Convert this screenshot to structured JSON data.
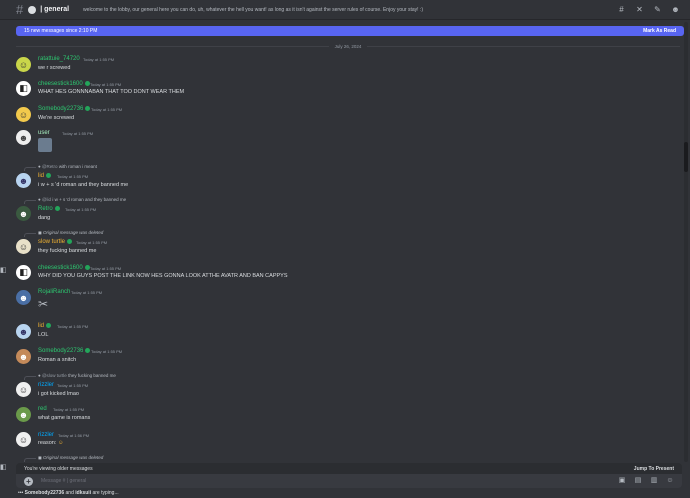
{
  "header": {
    "channel": "| general",
    "topic": "welcome to the lobby, our general here you can do, uh, whatever the hell you want! as long as it isn't against the server rules of course. Enjoy your stay! :)",
    "tools": [
      "threads-icon",
      "mute-bell-icon",
      "pin-icon",
      "members-icon"
    ]
  },
  "banner": {
    "text": "15 new messages since 2:10 PM",
    "action": "Mark As Read"
  },
  "date_divider": "July 26, 2024",
  "messages": [
    {
      "name": "ratattuie_74720",
      "time": "Today at 1:55 PM",
      "text": "we r screwed"
    },
    {
      "name": "cheesestick1600",
      "time": "Today at 1:55 PM",
      "text": "WHAT HES GONNNABAN THAT TOO DONT WEAR THEM"
    },
    {
      "name": "Somebody22736",
      "time": "Today at 1:55 PM",
      "text": "We're screwed"
    },
    {
      "name": "user",
      "time": "Today at 1:55 PM",
      "text": ""
    },
    {
      "reply_name": "@Retro",
      "reply_text": "with roman i meant",
      "name": "lid",
      "time": "Today at 1:55 PM",
      "text": "i w + s 'd roman and they banned me"
    },
    {
      "reply_name": "@lid",
      "reply_text": "i w + s 'd roman and they banned me",
      "name": "Retro",
      "time": "Today at 1:55 PM",
      "text": "dang"
    },
    {
      "reply_text": "Original message was deleted",
      "name": "slow turtle",
      "time": "Today at 1:55 PM",
      "text": "they fucking banned me"
    },
    {
      "name": "cheesestick1600",
      "time": "Today at 1:55 PM",
      "text": "WHY DID YOU GUYS POST THE LINK NOW HES GONNA LOOK ATTHE AVATR AND BAN CAPPYS"
    },
    {
      "name": "RojaliRanch",
      "time": "Today at 1:55 PM",
      "text": ""
    },
    {
      "name": "lid",
      "time": "Today at 1:55 PM",
      "text": "LOL"
    },
    {
      "name": "Somebody22736",
      "time": "Today at 1:55 PM",
      "text": "Roman a snitch"
    },
    {
      "reply_name": "@slow turtle",
      "reply_text": "they fucking banned me",
      "name": "rizzler",
      "time": "Today at 1:55 PM",
      "text": "i got kicked lmao"
    },
    {
      "name": "red",
      "time": "Today at 1:55 PM",
      "text": "what game is romans"
    },
    {
      "name": "rizzler",
      "time": "Today at 1:56 PM",
      "text": "reason:"
    },
    {
      "reply_text": "Original message was deleted"
    }
  ],
  "older_bar": {
    "text": "You're viewing older messages",
    "jump": "Jump To Present"
  },
  "composer": {
    "placeholder": "Message # | general"
  },
  "typing": {
    "names": "Somebody22736",
    "and": "and",
    "other": "idksuii",
    "suffix": "are typing..."
  }
}
